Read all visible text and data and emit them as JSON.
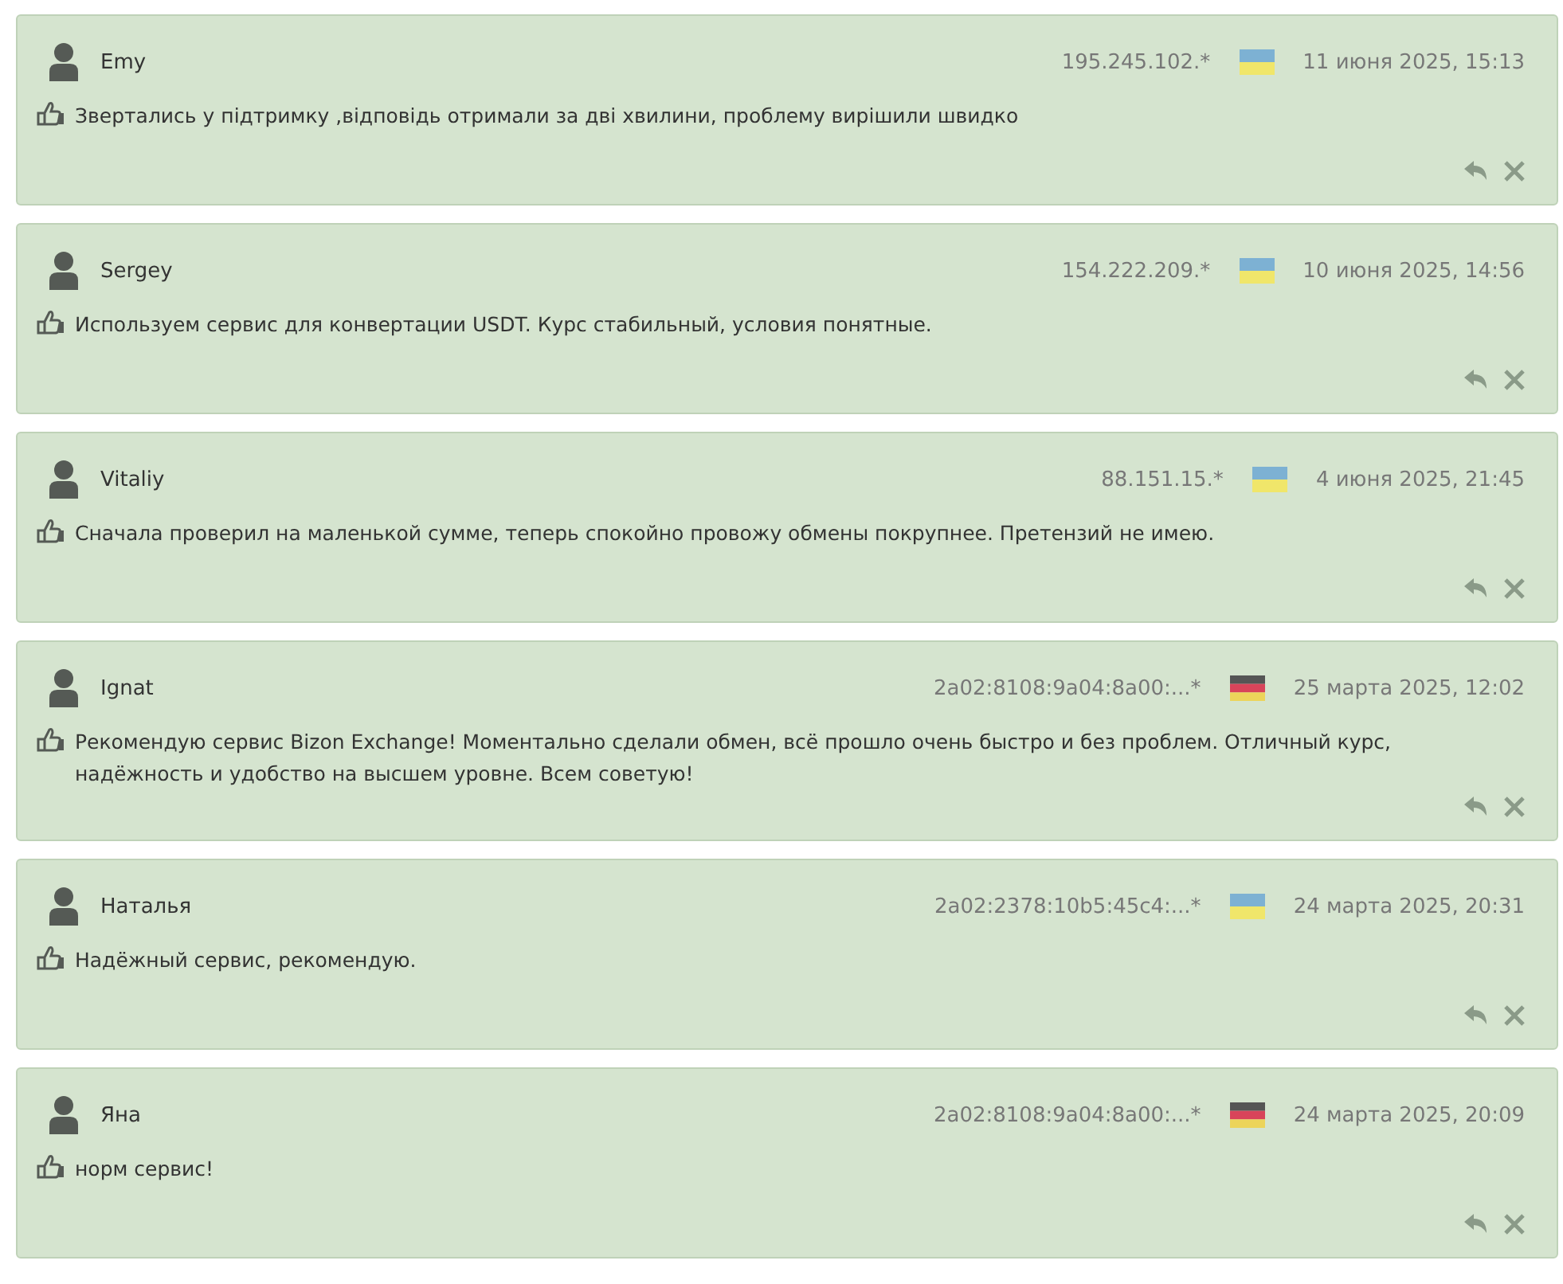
{
  "reviews": [
    {
      "author": "Emy",
      "ip": "195.245.102.*",
      "flag": {
        "kind": "ua"
      },
      "date": "11 июня 2025, 15:13",
      "text": "Звертались у підтримку ,відповідь отримали за дві хвилини, проблему вирішили швидко"
    },
    {
      "author": "Sergey",
      "ip": "154.222.209.*",
      "flag": {
        "kind": "ua"
      },
      "date": "10 июня 2025, 14:56",
      "text": "Используем сервис для конвертации USDT. Курс стабильный, условия понятные."
    },
    {
      "author": "Vitaliy",
      "ip": "88.151.15.*",
      "flag": {
        "kind": "ua"
      },
      "date": "4 июня 2025, 21:45",
      "text": "Сначала проверил на маленькой сумме, теперь спокойно провожу обмены покрупнее. Претензий не имею."
    },
    {
      "author": "Ignat",
      "ip": "2a02:8108:9a04:8a00:...*",
      "flag": {
        "kind": "de"
      },
      "date": "25 марта 2025, 12:02",
      "text": "Рекомендую сервис Bizon Exchange! Моментально сделали обмен, всё прошло очень быстро и без проблем. Отличный курс, надёжность и удобство на высшем уровне. Всем советую!"
    },
    {
      "author": "Наталья",
      "ip": "2a02:2378:10b5:45c4:...*",
      "flag": {
        "kind": "ua"
      },
      "date": "24 марта 2025, 20:31",
      "text": "Надёжный сервис, рекомендую."
    },
    {
      "author": "Яна",
      "ip": "2a02:8108:9a04:8a00:...*",
      "flag": {
        "kind": "de"
      },
      "date": "24 марта 2025, 20:09",
      "text": "норм сервис!"
    }
  ]
}
